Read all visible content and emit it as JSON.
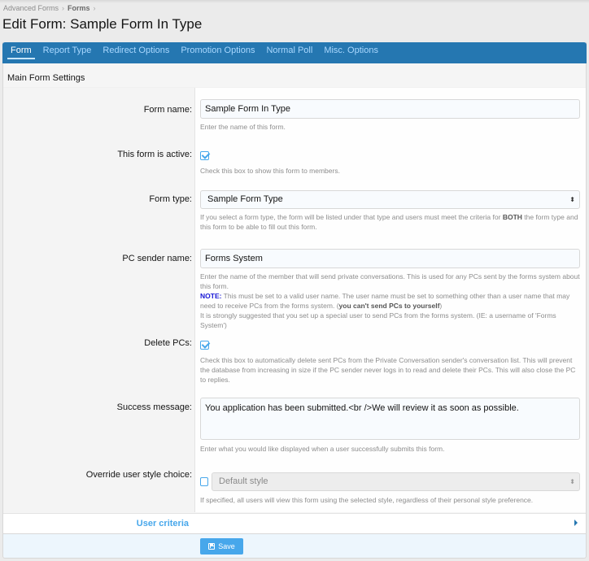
{
  "breadcrumb": [
    {
      "label": "Advanced Forms"
    },
    {
      "label": "Forms"
    }
  ],
  "breadcrumb_separator": "›",
  "page_title": "Edit Form: Sample Form In Type",
  "tabs": [
    {
      "label": "Form",
      "active": true
    },
    {
      "label": "Report Type",
      "active": false
    },
    {
      "label": "Redirect Options",
      "active": false
    },
    {
      "label": "Promotion Options",
      "active": false
    },
    {
      "label": "Normal Poll",
      "active": false
    },
    {
      "label": "Misc. Options",
      "active": false
    }
  ],
  "section_title": "Main Form Settings",
  "fields": {
    "form_name": {
      "label": "Form name:",
      "value": "Sample Form In Type",
      "hint": "Enter the name of this form."
    },
    "active": {
      "label": "This form is active:",
      "checked": true,
      "hint": "Check this box to show this form to members."
    },
    "form_type": {
      "label": "Form type:",
      "selected": "Sample Form Type",
      "hint_pre": "If you select a form type, the form will be listed under that type and users must meet the criteria for ",
      "hint_bold": "BOTH",
      "hint_post": " the form type and this form to be able to fill out this form."
    },
    "pc_sender": {
      "label": "PC sender name:",
      "value": "Forms System",
      "hint_1": "Enter the name of the member that will send private conversations. This is used for any PCs sent by the forms system about this form.",
      "note_label": "NOTE:",
      "hint_2": " This must be set to a valid user name. The user name must be set to something other than a user name that may need to receive PCs from the forms system. (",
      "hint_2_bold": "you can't send PCs to yourself",
      "hint_2_end": ")",
      "hint_3": "It is strongly suggested that you set up a special user to send PCs from the forms system. (IE: a username of 'Forms System')"
    },
    "delete_pcs": {
      "label": "Delete PCs:",
      "checked": true,
      "hint": "Check this box to automatically delete sent PCs from the Private Conversation sender's conversation list. This will prevent the database from increasing in size if the PC sender never logs in to read and delete their PCs. This will also close the PC to replies."
    },
    "success_message": {
      "label": "Success message:",
      "value": "You application has been submitted.<br />We will review it as soon as possible.",
      "hint": "Enter what you would like displayed when a user successfully submits this form."
    },
    "override_style": {
      "label": "Override user style choice:",
      "checked": false,
      "selected": "Default style",
      "hint": "If specified, all users will view this form using the selected style, regardless of their personal style preference."
    }
  },
  "user_criteria_label": "User criteria",
  "save_label": "Save",
  "colors": {
    "tab_bar": "#2577b1",
    "accent": "#47a7eb",
    "note": "#1717d6"
  }
}
